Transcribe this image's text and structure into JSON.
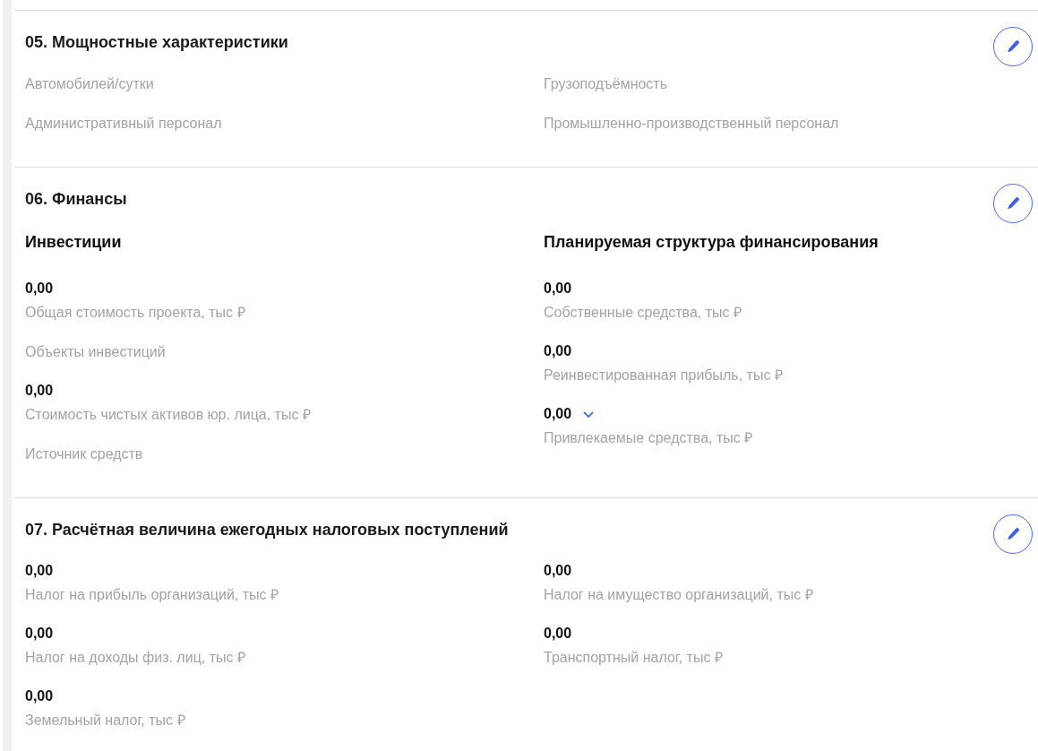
{
  "sections": [
    {
      "title": "05. Мощностные характеристики",
      "columns": [
        {
          "items": [
            {
              "kind": "label",
              "label": "Автомобилей/сутки"
            },
            {
              "kind": "label",
              "label": "Административный персонал"
            }
          ]
        },
        {
          "items": [
            {
              "kind": "label",
              "label": "Грузоподъёмность"
            },
            {
              "kind": "label",
              "label": "Промышленно-производственный персонал"
            }
          ]
        }
      ]
    },
    {
      "title": "06. Финансы",
      "columns": [
        {
          "heading": "Инвестиции",
          "items": [
            {
              "kind": "value",
              "value": "0,00",
              "label": "Общая стоимость проекта, тыс ₽",
              "expandable": false
            },
            {
              "kind": "label",
              "label": "Объекты инвестиций"
            },
            {
              "kind": "value",
              "value": "0,00",
              "label": "Стоимость чистых активов юр. лица, тыс ₽",
              "expandable": false
            },
            {
              "kind": "label",
              "label": "Источник средств"
            }
          ]
        },
        {
          "heading": "Планируемая структура финансирования",
          "items": [
            {
              "kind": "value",
              "value": "0,00",
              "label": "Собственные средства, тыс ₽",
              "expandable": false
            },
            {
              "kind": "value",
              "value": "0,00",
              "label": "Реинвестированная прибыль, тыс ₽",
              "expandable": false
            },
            {
              "kind": "value",
              "value": "0,00",
              "label": "Привлекаемые средства, тыс ₽",
              "expandable": true
            }
          ]
        }
      ]
    },
    {
      "title": "07. Расчётная величина ежегодных налоговых поступлений",
      "columns": [
        {
          "items": [
            {
              "kind": "value",
              "value": "0,00",
              "label": "Налог на прибыль организаций, тыс ₽",
              "expandable": false
            },
            {
              "kind": "value",
              "value": "0,00",
              "label": "Налог на доходы физ. лиц, тыс ₽",
              "expandable": false
            },
            {
              "kind": "value",
              "value": "0,00",
              "label": "Земельный налог, тыс ₽",
              "expandable": false
            }
          ]
        },
        {
          "items": [
            {
              "kind": "value",
              "value": "0,00",
              "label": "Налог на имущество организаций, тыс ₽",
              "expandable": false
            },
            {
              "kind": "value",
              "value": "0,00",
              "label": "Транспортный налог, тыс ₽",
              "expandable": false
            }
          ]
        }
      ]
    }
  ]
}
